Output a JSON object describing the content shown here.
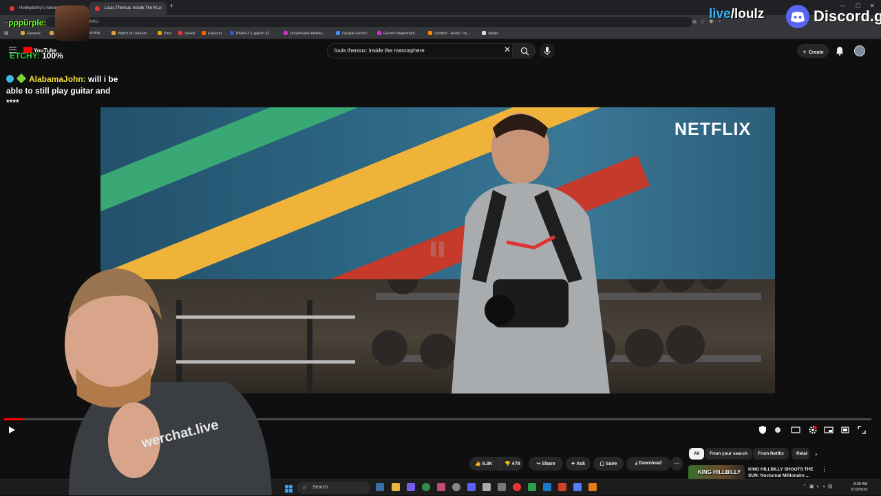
{
  "browser": {
    "tabs": [
      {
        "title": "Hotkkytokky's interacti...",
        "active": false
      },
      {
        "title": "Louis Theroux: Inside The M...",
        "active": true
      }
    ],
    "url": "ych?v=Ms23Fe/WvKU",
    "bookmarks": [
      {
        "label": "General",
        "icon_color": "#e0a040"
      },
      {
        "label": "Sc",
        "icon_color": "#e0a040"
      },
      {
        "label": "Streaming",
        "icon_color": "#e0a040"
      },
      {
        "label": "Watch on Stream",
        "icon_color": "#e0a040"
      },
      {
        "label": "Plex",
        "icon_color": "#e5a00d"
      },
      {
        "label": "Saved",
        "icon_color": "#e33"
      },
      {
        "label": "Explorer",
        "icon_color": "#f60"
      },
      {
        "label": "RM43-2 1-gallon 32...",
        "icon_color": "#35c"
      },
      {
        "label": "DreamHack Atlanta...",
        "icon_color": "#c3c"
      },
      {
        "label": "Google Gemini",
        "icon_color": "#4a8af4"
      },
      {
        "label": "Gemini Watermark...",
        "icon_color": "#c3c"
      },
      {
        "label": "Scriberr - Audio Tra...",
        "icon_color": "#f80"
      },
      {
        "label": "skipits",
        "icon_color": "#ddd"
      }
    ]
  },
  "youtube": {
    "logo_text": "YouTube",
    "search": {
      "value": "louis theroux: inside the manosphere"
    },
    "create_label": "Create"
  },
  "overlay": {
    "chatter_name": "pppurple:",
    "etchy_label": "ETCHY:",
    "etchy_value": "100%",
    "chat": {
      "user": "AlabamaJohn:",
      "message": "will i be able to still play guitar and ****"
    },
    "livelouz": {
      "prefix": "live",
      "suffix": "/loulz"
    },
    "discord": "Discord.gg",
    "shirt_text": "werchat.live"
  },
  "video": {
    "brand_text": "NETFLIX",
    "progress_fraction": 0.022
  },
  "actions": {
    "likes": "8.3K",
    "dislikes": "478",
    "share": "Share",
    "ask": "Ask",
    "save": "Save",
    "download": "Download"
  },
  "chips": [
    "All",
    "From your search",
    "From Netflix",
    "Relat"
  ],
  "recommendation": {
    "thumb_text": "KING HILLBILLY",
    "title": "KING HILLBILLY SHOOTS THE SUN: Nocturnal Millionaire ..."
  },
  "taskbar": {
    "search_placeholder": "Search",
    "time": "8:30 AM",
    "date": "3/12/2026"
  },
  "colors": {
    "progress": "#ff0000",
    "chat_user": "#f5e13b",
    "chatter_name": "#7cff3a"
  }
}
